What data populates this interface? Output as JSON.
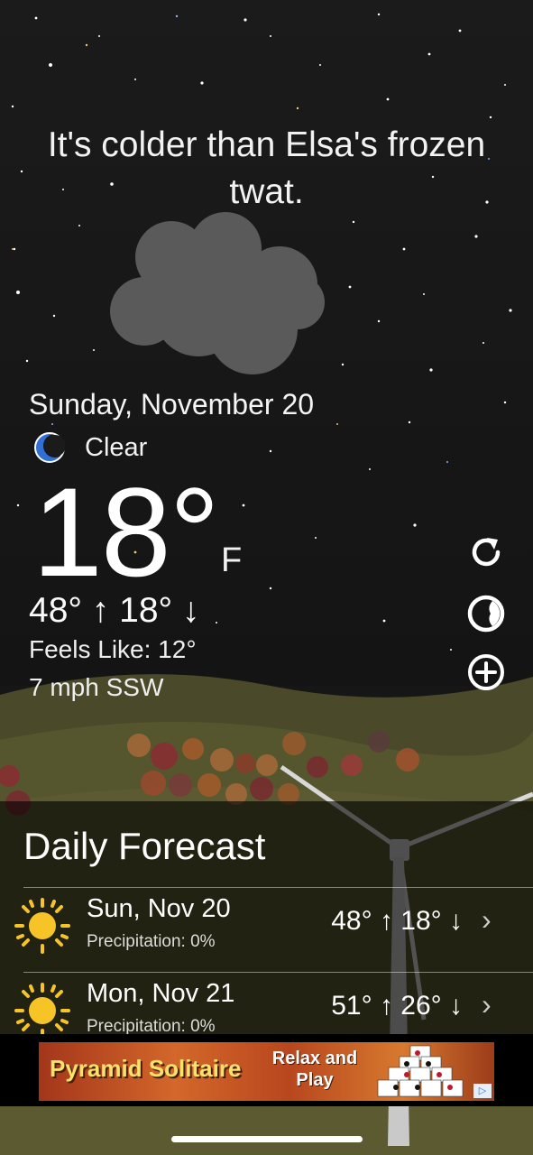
{
  "headline": "It's colder than Elsa's frozen twat.",
  "current": {
    "date": "Sunday, November 20",
    "condition": "Clear",
    "condition_icon": "moon-icon",
    "temp": "18°",
    "unit": "F",
    "hilo": "48° ↑ 18° ↓",
    "feels_like": "Feels Like: 12°",
    "wind": "7 mph SSW"
  },
  "side_buttons": [
    "refresh-icon",
    "theme-icon",
    "add-icon"
  ],
  "forecast": {
    "title": "Daily Forecast",
    "days": [
      {
        "day": "Sun, Nov 20",
        "precip": "Precipitation: 0%",
        "temps": "48° ↑  18° ↓",
        "icon": "sun-icon"
      },
      {
        "day": "Mon, Nov 21",
        "precip": "Precipitation: 0%",
        "temps": "51° ↑  26° ↓",
        "icon": "sun-icon"
      }
    ]
  },
  "ad": {
    "title": "Pyramid Solitaire",
    "sub": "Relax and Play"
  },
  "colors": {
    "accent": "#2f6fd6",
    "sun": "#f6c427",
    "panel": "#000000"
  }
}
